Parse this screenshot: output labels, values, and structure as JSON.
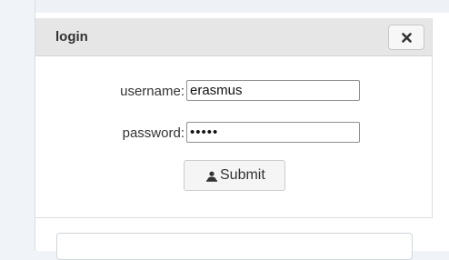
{
  "dialog": {
    "title": "login",
    "close_icon": "close-icon"
  },
  "form": {
    "username_label": "username:",
    "username_value": "erasmus",
    "password_label": "password:",
    "password_value": "•••••",
    "submit_label": "Submit",
    "submit_icon": "user-login-icon"
  },
  "colors": {
    "header_bg": "#e6e6e6",
    "page_bg": "#f0f4f8",
    "button_bg": "#f5f5f5",
    "text": "#333333"
  }
}
